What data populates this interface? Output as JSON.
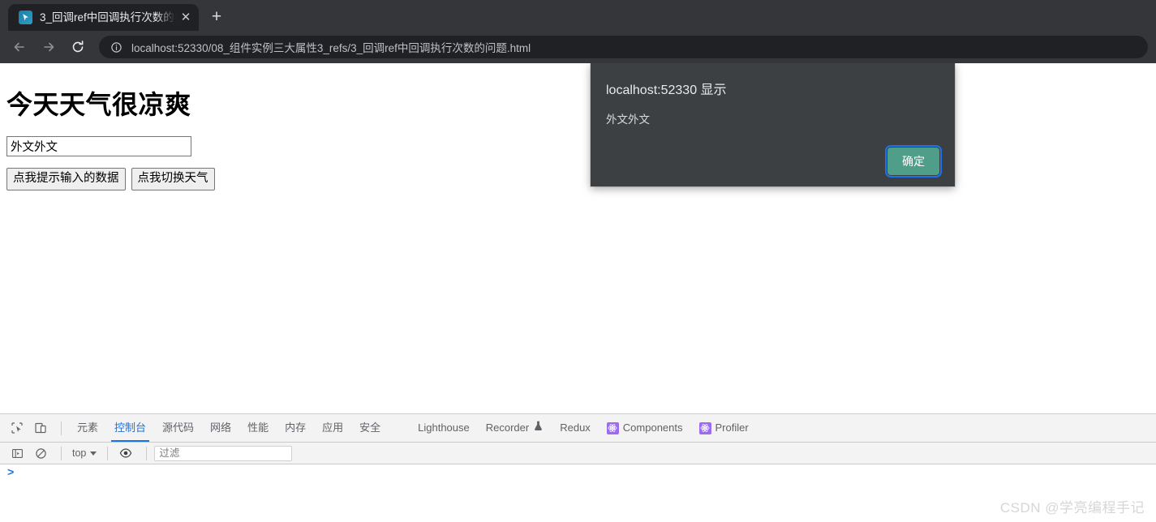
{
  "browser": {
    "tab": {
      "title": "3_回调ref中回调执行次数的问题.html",
      "favicon_name": "cursor-arrow-favicon",
      "close_label": "✕"
    },
    "new_tab_label": "+",
    "nav": {
      "back_label": "←",
      "forward_label": "→",
      "reload_label": "⟳"
    },
    "omnibox": {
      "url": "localhost:52330/08_组件实例三大属性3_refs/3_回调ref中回调执行次数的问题.html",
      "info_icon": "site-information-icon"
    }
  },
  "page": {
    "heading": "今天天气很凉爽",
    "input_value": "外文外文",
    "input_placeholder": "",
    "buttons": [
      {
        "label": "点我提示输入的数据",
        "name": "show-input-data-button"
      },
      {
        "label": "点我切换天气",
        "name": "toggle-weather-button"
      }
    ]
  },
  "dialog": {
    "title": "localhost:52330 显示",
    "message": "外文外文",
    "ok_label": "确定",
    "bg_color": "#3c4043",
    "ok_button_color": "#4e9e8a",
    "focus_ring_color": "#1a73e8"
  },
  "devtools": {
    "left_icons": [
      {
        "name": "inspect-element-icon"
      },
      {
        "name": "device-toolbar-icon"
      }
    ],
    "tabs": [
      {
        "label": "元素",
        "name": "tab-elements",
        "active": false,
        "icon": null
      },
      {
        "label": "控制台",
        "name": "tab-console",
        "active": true,
        "icon": null
      },
      {
        "label": "源代码",
        "name": "tab-sources",
        "active": false,
        "icon": null
      },
      {
        "label": "网络",
        "name": "tab-network",
        "active": false,
        "icon": null
      },
      {
        "label": "性能",
        "name": "tab-performance",
        "active": false,
        "icon": null
      },
      {
        "label": "内存",
        "name": "tab-memory",
        "active": false,
        "icon": null
      },
      {
        "label": "应用",
        "name": "tab-application",
        "active": false,
        "icon": null
      },
      {
        "label": "安全",
        "name": "tab-security",
        "active": false,
        "icon": null
      },
      {
        "label": "Lighthouse",
        "name": "tab-lighthouse",
        "active": false,
        "icon": null
      },
      {
        "label": "Recorder",
        "name": "tab-recorder",
        "active": false,
        "icon": "flask-icon"
      },
      {
        "label": "Redux",
        "name": "tab-redux",
        "active": false,
        "icon": null
      },
      {
        "label": "Components",
        "name": "tab-components",
        "active": false,
        "icon": "react-logo-icon"
      },
      {
        "label": "Profiler",
        "name": "tab-profiler",
        "active": false,
        "icon": "react-logo-icon"
      }
    ],
    "console_toolbar": {
      "sidebar_icon": "console-sidebar-icon",
      "clear_icon": "clear-console-icon",
      "context": "top",
      "eye_icon": "live-expression-icon",
      "filter_placeholder": "过滤"
    },
    "prompt_symbol": ">",
    "accent_color": "#1a73e8"
  },
  "watermark": "CSDN @学亮编程手记"
}
